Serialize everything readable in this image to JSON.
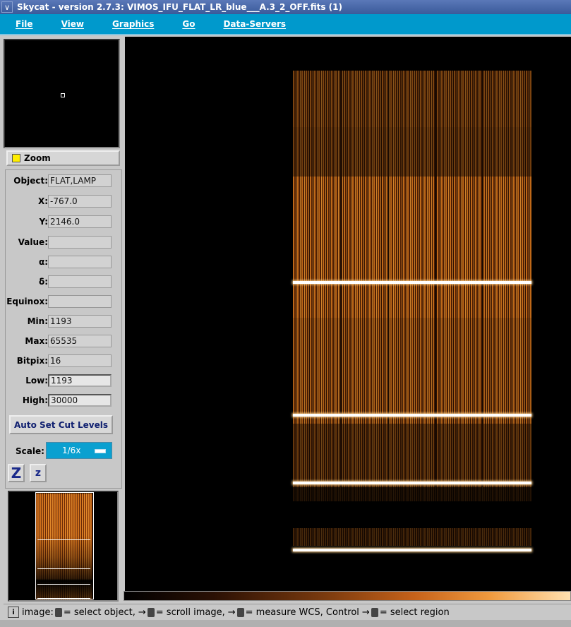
{
  "window": {
    "title": "Skycat - version 2.7.3: VIMOS_IFU_FLAT_LR_blue___A.3_2_OFF.fits (1)"
  },
  "menu": [
    "File",
    "View",
    "Graphics",
    "Go",
    "Data-Servers"
  ],
  "zoom": {
    "label": "Zoom"
  },
  "fields": [
    {
      "key": "Object:",
      "value": "FLAT,LAMP"
    },
    {
      "key": "X:",
      "value": "-767.0"
    },
    {
      "key": "Y:",
      "value": "2146.0"
    },
    {
      "key": "Value:",
      "value": ""
    },
    {
      "key": "α:",
      "value": ""
    },
    {
      "key": "δ:",
      "value": ""
    },
    {
      "key": "Equinox:",
      "value": ""
    },
    {
      "key": "Min:",
      "value": "1193"
    },
    {
      "key": "Max:",
      "value": "65535"
    },
    {
      "key": "Bitpix:",
      "value": "16"
    },
    {
      "key": "Low:",
      "value": "1193"
    },
    {
      "key": "High:",
      "value": "30000"
    }
  ],
  "controls": {
    "autocut": "Auto Set Cut Levels",
    "scale_label": "Scale:",
    "scale_value": "1/6x",
    "zoom_in": "Z",
    "zoom_out": "z"
  },
  "status": {
    "p1": "image:",
    "p2": "= select object,",
    "p3": "= scroll image,",
    "p4": "= measure WCS, Control",
    "p5": "= select region"
  },
  "colors": {
    "title_bg": "#3a5a9a",
    "menu_bg": "#0099cc",
    "accent": "#e07a1c"
  }
}
